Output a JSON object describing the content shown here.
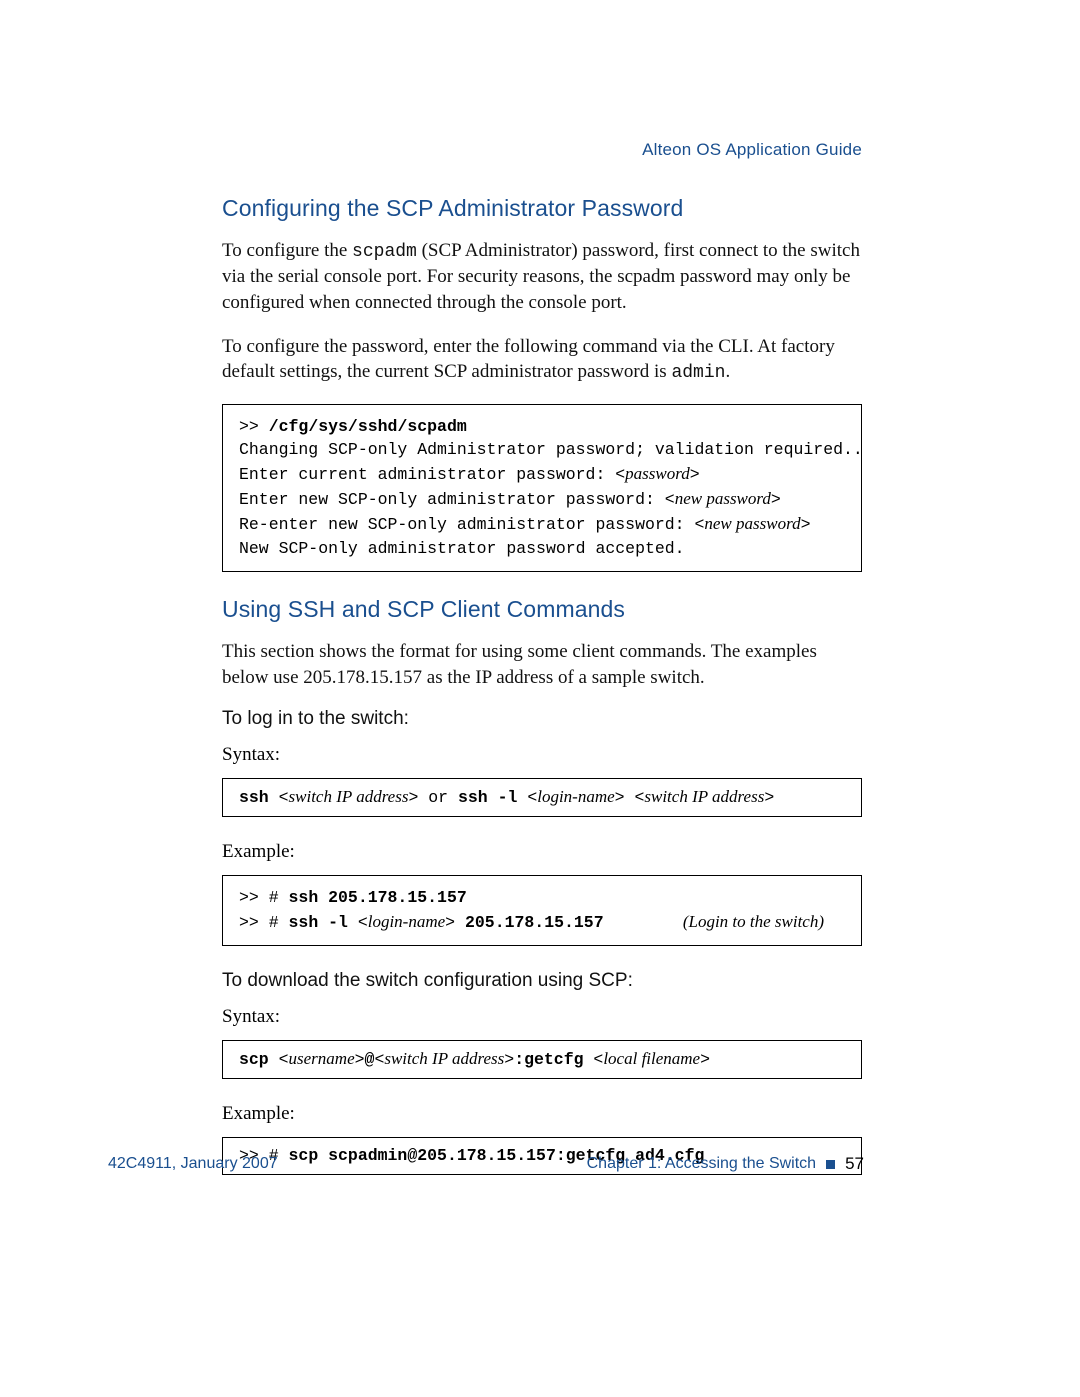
{
  "running_head": "Alteon OS  Application Guide",
  "sec1": {
    "heading": "Configuring the SCP Administrator Password",
    "p1_a": "To configure the ",
    "p1_code": "scpadm",
    "p1_b": " (SCP Administrator) password, first connect to the switch via the serial console port. For security reasons, the scpadm password may only be configured when connected through the console port.",
    "p2_a": "To configure the password, enter the following command via the CLI. At factory default settings, the current SCP administrator password is ",
    "p2_code": "admin",
    "p2_b": ".",
    "code": {
      "l1a": ">> ",
      "l1b": "/cfg/sys/sshd/scpadm",
      "l2": "Changing SCP-only Administrator password; validation required...",
      "l3a": "Enter current administrator password: ",
      "l3b": "<",
      "l3_ital": "password",
      "l3c": ">",
      "l4a": "Enter new SCP-only administrator password: ",
      "l4b": "<",
      "l4_ital": "new password",
      "l4c": ">",
      "l5a": "Re-enter new SCP-only administrator password: ",
      "l5b": "<",
      "l5_ital": "new password",
      "l5c": ">",
      "l6": "New SCP-only administrator password accepted."
    }
  },
  "sec2": {
    "heading": "Using SSH and SCP Client Commands",
    "p1": "This section shows the format for using some client commands. The examples below use 205.178.15.157 as the IP address of a sample switch.",
    "sub1": "To log in to the switch:",
    "syntax_label": "Syntax:",
    "syntax1": {
      "b1": "ssh ",
      "t1": "<",
      "i1": "switch IP address",
      "t2": "> ",
      "plain": "or ",
      "b2": "ssh -l ",
      "t3": "<",
      "i2": "login-name",
      "t4": "> <",
      "i3": "switch IP address",
      "t5": ">"
    },
    "example_label": "Example:",
    "example1": {
      "l1a": ">> # ",
      "l1b": "ssh 205.178.15.157",
      "l2a": ">> # ",
      "l2b": "ssh -l ",
      "l2c": "<",
      "l2_ital1": "login-name",
      "l2d": "> ",
      "l2e": "205.178.15.157",
      "l2_pad": "        ",
      "l2_ital2": "(Login to the switch)"
    },
    "sub2": "To download the switch configuration using SCP:",
    "syntax2": {
      "b1": "scp ",
      "t1": "<",
      "i1": "username",
      "t2": ">",
      "b2": "@",
      "t3": "<",
      "i2": "switch IP address",
      "t4": ">",
      "b3": ":getcfg ",
      "t5": "<",
      "i3": "local filename",
      "t6": ">"
    },
    "example2": {
      "l1a": ">> # ",
      "l1b": "scp scpadmin@205.178.15.157:getcfg ad4.cfg"
    }
  },
  "footer": {
    "left": "42C4911, January 2007",
    "chapter": "Chapter 1:  Accessing the Switch",
    "page": "57"
  }
}
